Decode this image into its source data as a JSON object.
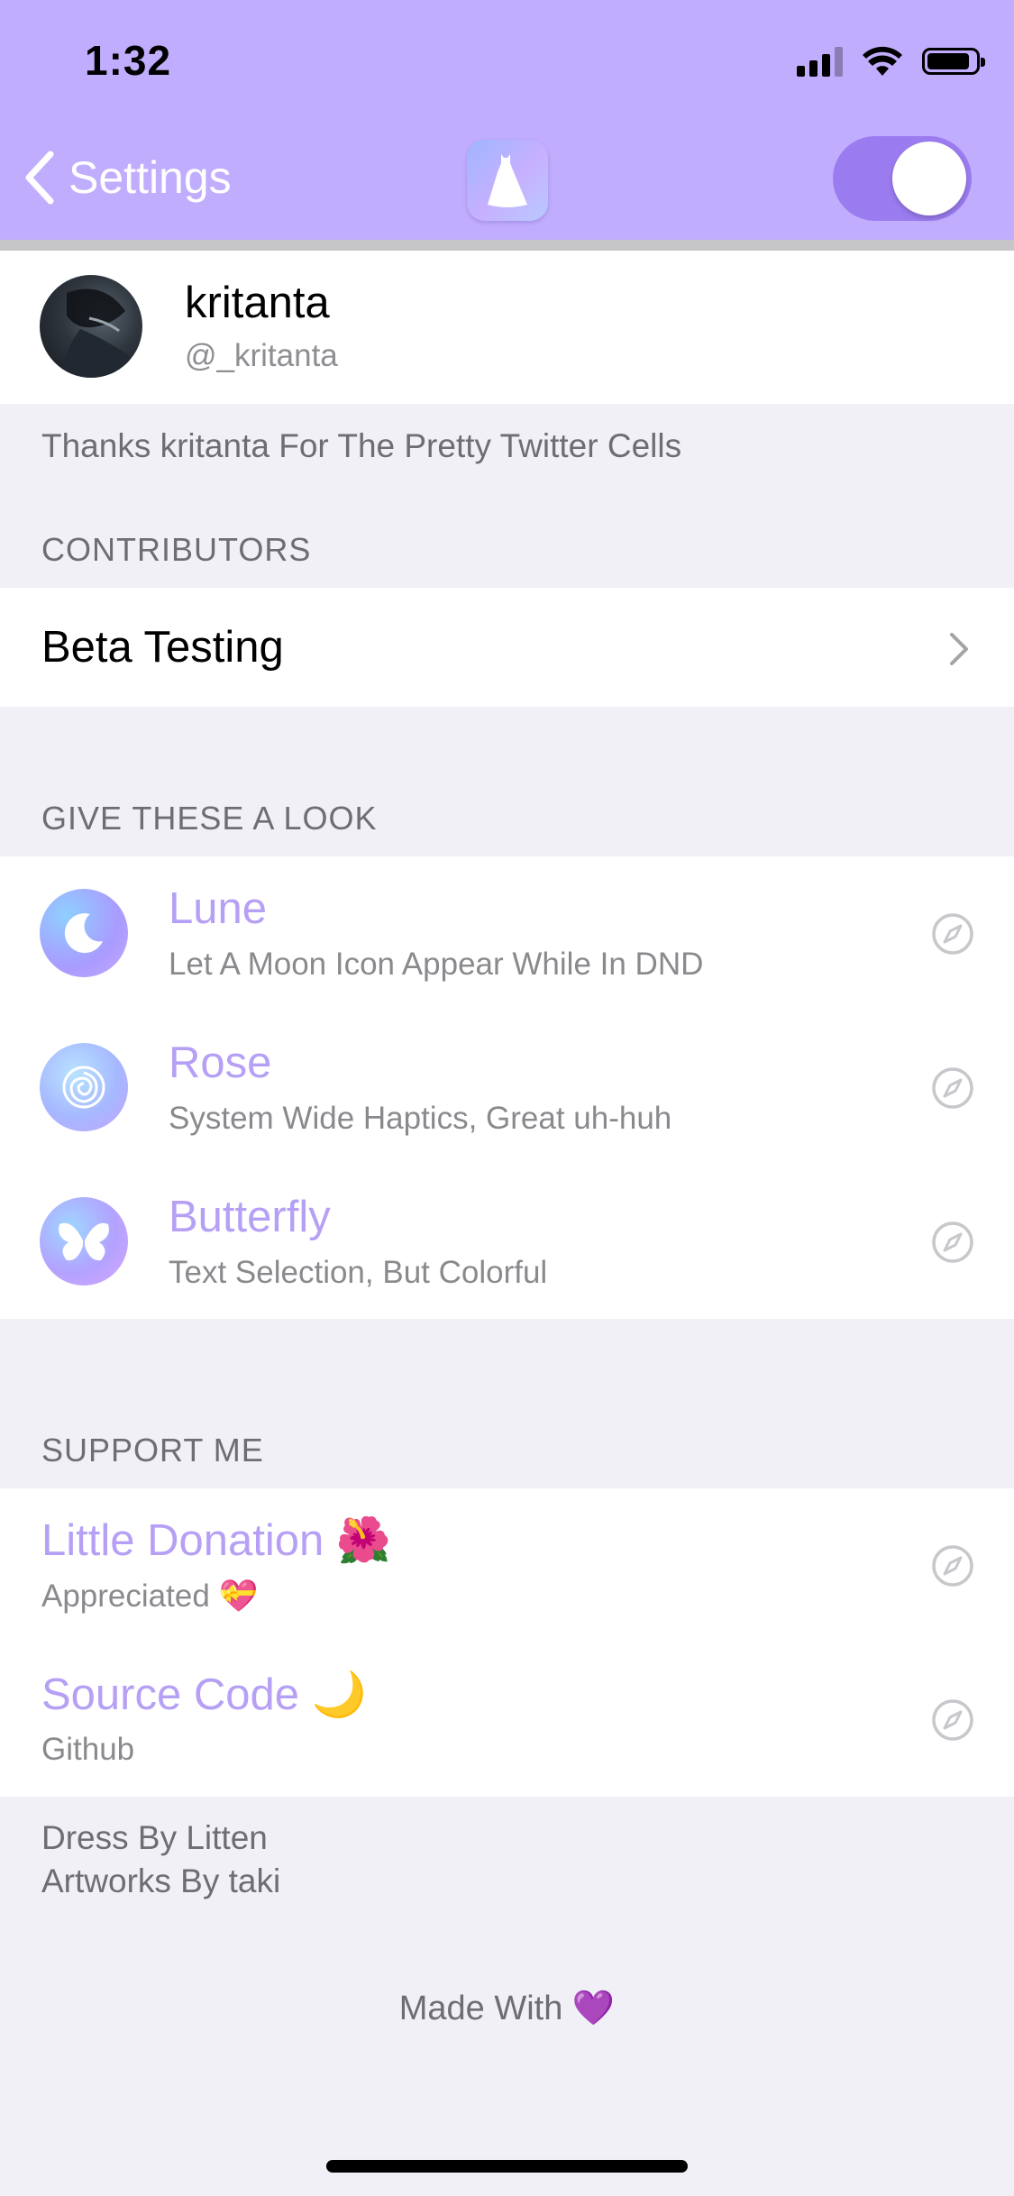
{
  "status_bar": {
    "time": "1:32"
  },
  "nav": {
    "back_label": "Settings",
    "app_icon": "dress-icon",
    "toggle_on": true,
    "accent_color": "#c1adfd"
  },
  "profile": {
    "name": "kritanta",
    "handle": "@_kritanta",
    "footer": "Thanks kritanta For The Pretty Twitter Cells"
  },
  "contributors": {
    "header": "CONTRIBUTORS",
    "row_label": "Beta Testing"
  },
  "look": {
    "header": "GIVE THESE A LOOK",
    "items": [
      {
        "title": "Lune",
        "subtitle": "Let A Moon Icon Appear While In DND",
        "icon": "moon-icon"
      },
      {
        "title": "Rose",
        "subtitle": "System Wide Haptics, Great uh-huh",
        "icon": "rose-icon"
      },
      {
        "title": "Butterfly",
        "subtitle": "Text Selection, But Colorful",
        "icon": "butterfly-icon"
      }
    ]
  },
  "support": {
    "header": "SUPPORT ME",
    "items": [
      {
        "title": "Little Donation",
        "title_emoji": "🌺",
        "subtitle": "Appreciated",
        "subtitle_emoji": "💝"
      },
      {
        "title": "Source Code",
        "title_emoji": "🌙",
        "subtitle": "Github",
        "subtitle_emoji": ""
      }
    ]
  },
  "credits": {
    "line1": "Dress By Litten",
    "line2": "Artworks By taki"
  },
  "made_with": {
    "label": "Made With",
    "emoji": "💜"
  }
}
